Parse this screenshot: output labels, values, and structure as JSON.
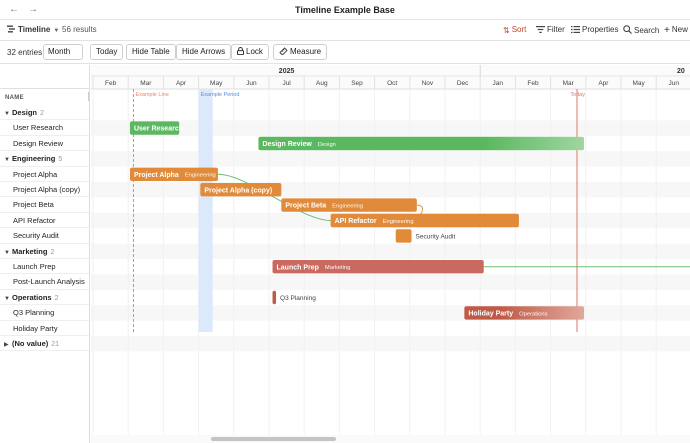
{
  "window": {
    "title": "Timeline Example Base",
    "back": "←",
    "forward": "→"
  },
  "viewbar": {
    "view_name": "Timeline",
    "results": "56 results",
    "sort": "Sort",
    "filter": "Filter",
    "properties": "Properties",
    "search": "Search",
    "new": "New"
  },
  "controls": {
    "entries": "32 entries",
    "zoom": "Month",
    "today": "Today",
    "hide_table": "Hide Table",
    "hide_arrows": "Hide Arrows",
    "lock": "Lock",
    "measure": "Measure"
  },
  "sidebar": {
    "header": "NAME",
    "rows": [
      {
        "type": "group",
        "label": "Design",
        "count": "2"
      },
      {
        "type": "item",
        "label": "User Research"
      },
      {
        "type": "item",
        "label": "Design Review"
      },
      {
        "type": "group",
        "label": "Engineering",
        "count": "5"
      },
      {
        "type": "item",
        "label": "Project Alpha"
      },
      {
        "type": "item",
        "label": "Project Alpha (copy)"
      },
      {
        "type": "item",
        "label": "Project Beta"
      },
      {
        "type": "item",
        "label": "API Refactor"
      },
      {
        "type": "item",
        "label": "Security Audit"
      },
      {
        "type": "group",
        "label": "Marketing",
        "count": "2"
      },
      {
        "type": "item",
        "label": "Launch Prep"
      },
      {
        "type": "item",
        "label": "Post-Launch Analysis"
      },
      {
        "type": "group",
        "label": "Operations",
        "count": "2"
      },
      {
        "type": "item",
        "label": "Q3 Planning"
      },
      {
        "type": "item",
        "label": "Holiday Party"
      },
      {
        "type": "group",
        "label": "(No value)",
        "count": "21",
        "collapsed": true
      }
    ]
  },
  "timeline": {
    "years": [
      {
        "label": "2025",
        "month_index": 5.5
      },
      {
        "label": "20",
        "month_index": 16.7
      }
    ],
    "months": [
      "Feb",
      "Mar",
      "Apr",
      "May",
      "Jun",
      "Jul",
      "Aug",
      "Sep",
      "Oct",
      "Nov",
      "Dec",
      "Jan",
      "Feb",
      "Mar",
      "Apr",
      "May",
      "Jun"
    ],
    "markers": [
      {
        "label": "Example Line",
        "month": 1.15,
        "style": "dashed",
        "color": "#e0896f"
      },
      {
        "label": "Today",
        "month": 13.75,
        "style": "solid",
        "color": "#d97a63"
      }
    ],
    "periods": [
      {
        "label": "Example Period",
        "start": 3.0,
        "end": 3.4,
        "color": "#dce8fb",
        "text_color": "#5b8ed6"
      }
    ],
    "colors": {
      "design": "#5cb860",
      "engineering": "#e08a3a",
      "marketing": "#c9695f",
      "operations": "#c05a46"
    },
    "bars": [
      {
        "label": "User Research",
        "tag": "",
        "row": 1,
        "start": 1.05,
        "end": 2.45,
        "color": "#5cb860"
      },
      {
        "label": "Design Review",
        "tag": "Design",
        "row": 2,
        "start": 4.7,
        "end": 13.95,
        "color": "#5cb860",
        "fade": true
      },
      {
        "label": "Project Alpha",
        "tag": "Engineering",
        "row": 4,
        "start": 1.05,
        "end": 3.55,
        "color": "#e08a3a"
      },
      {
        "label": "Project Alpha (copy)",
        "tag": "",
        "row": 5,
        "start": 3.05,
        "end": 5.35,
        "color": "#e08a3a"
      },
      {
        "label": "Project Beta",
        "tag": "Engineering",
        "row": 6,
        "start": 5.35,
        "end": 9.2,
        "color": "#e08a3a"
      },
      {
        "label": "API Refactor",
        "tag": "Engineering",
        "row": 7,
        "start": 6.75,
        "end": 12.1,
        "color": "#e08a3a"
      },
      {
        "label": "Launch Prep",
        "tag": "Marketing",
        "row": 10,
        "start": 5.1,
        "end": 11.1,
        "color": "#c9695f"
      },
      {
        "label": "Holiday Party",
        "tag": "Operations",
        "row": 13,
        "start": 10.55,
        "end": 13.95,
        "color": "#c05a46",
        "fade": true
      }
    ],
    "points": [
      {
        "label": "Security Audit",
        "row": 8,
        "month": 8.6,
        "width": 0.45,
        "color": "#e08a3a"
      },
      {
        "label": "Q3 Planning",
        "row": 12,
        "month": 5.1,
        "width": 0.1,
        "color": "#c05a46"
      }
    ],
    "arrows": [
      {
        "from_row": 4,
        "from_month": 3.55,
        "to_row": 7,
        "to_month": 6.75,
        "color": "#5cb860"
      },
      {
        "from_row": 6,
        "from_month": 9.2,
        "to_row": 7,
        "to_month": 9.0,
        "color": "#e08a3a"
      },
      {
        "from_row": 10,
        "from_month": 11.1,
        "to_row": 10,
        "to_month": 17.5,
        "color": "#5cb860"
      }
    ]
  }
}
